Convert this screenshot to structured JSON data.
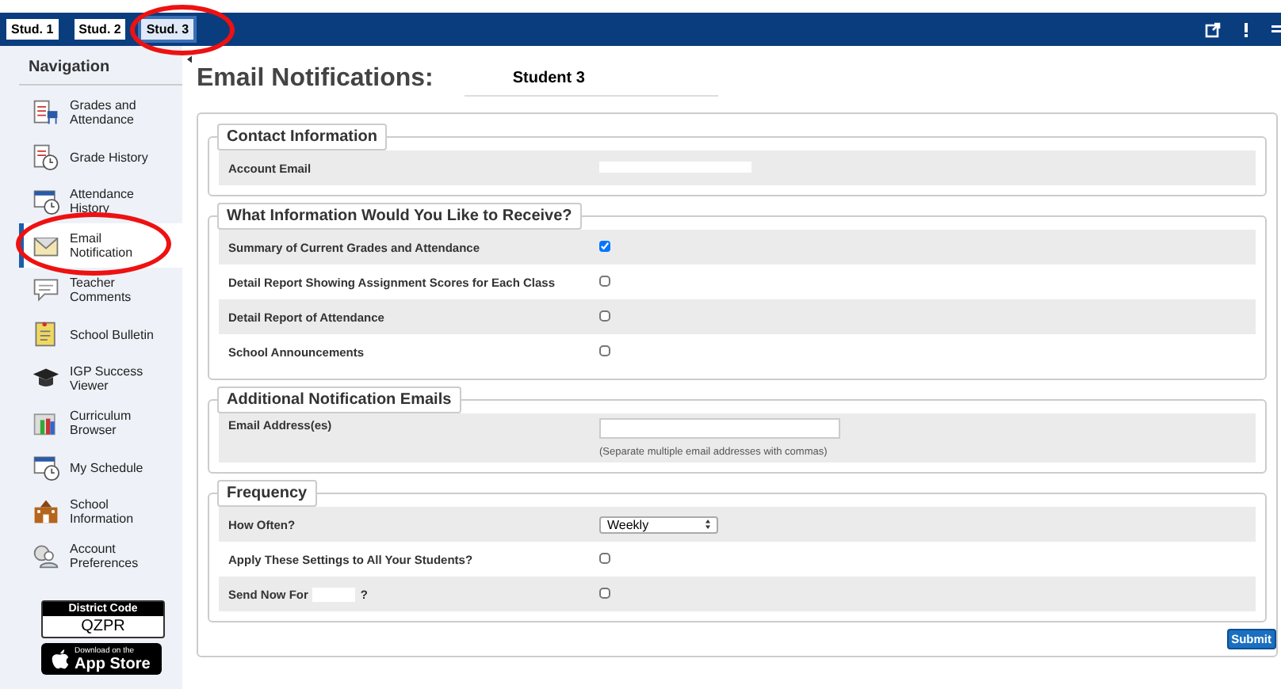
{
  "tabs": [
    {
      "label": "Stud. 1",
      "selected": false
    },
    {
      "label": "Stud. 2",
      "selected": false
    },
    {
      "label": "Stud. 3",
      "selected": true
    }
  ],
  "navigation": {
    "heading": "Navigation",
    "items": [
      {
        "label": "Grades and Attendance",
        "selected": false
      },
      {
        "label": "Grade History",
        "selected": false
      },
      {
        "label": "Attendance History",
        "selected": false
      },
      {
        "label": "Email Notification",
        "selected": true
      },
      {
        "label": "Teacher Comments",
        "selected": false
      },
      {
        "label": "School Bulletin",
        "selected": false
      },
      {
        "label": "IGP Success Viewer",
        "selected": false
      },
      {
        "label": "Curriculum Browser",
        "selected": false
      },
      {
        "label": "My Schedule",
        "selected": false
      },
      {
        "label": "School Information",
        "selected": false
      },
      {
        "label": "Account Preferences",
        "selected": false
      }
    ]
  },
  "district_code": {
    "label": "District Code",
    "value": "QZPR"
  },
  "app_store_badge": {
    "small": "Download on the",
    "big": "App Store"
  },
  "page": {
    "title": "Email Notifications:",
    "student": "Student 3"
  },
  "sections": [
    {
      "legend": "Contact Information",
      "rows": [
        {
          "label": "Account Email",
          "kind": "redacted"
        }
      ]
    },
    {
      "legend": "What Information Would You Like to Receive?",
      "rows": [
        {
          "label": "Summary of Current Grades and Attendance",
          "kind": "checkbox",
          "checked": true
        },
        {
          "label": "Detail Report Showing Assignment Scores for Each Class",
          "kind": "checkbox",
          "checked": false
        },
        {
          "label": "Detail Report of Attendance",
          "kind": "checkbox",
          "checked": false
        },
        {
          "label": "School Announcements",
          "kind": "checkbox",
          "checked": false
        }
      ]
    },
    {
      "legend": "Additional Notification Emails",
      "rows": [
        {
          "label": "Email Address(es)",
          "kind": "input",
          "hint": "(Separate multiple email addresses with commas)"
        }
      ]
    },
    {
      "legend": "Frequency",
      "rows": [
        {
          "label": "How Often?",
          "kind": "select",
          "value": "Weekly"
        },
        {
          "label": "Apply These Settings to All Your Students?",
          "kind": "checkbox",
          "checked": false
        },
        {
          "label": "Send Now For",
          "label_suffix": "?",
          "kind": "checkbox",
          "checked": false
        }
      ]
    }
  ],
  "submit": "Submit"
}
